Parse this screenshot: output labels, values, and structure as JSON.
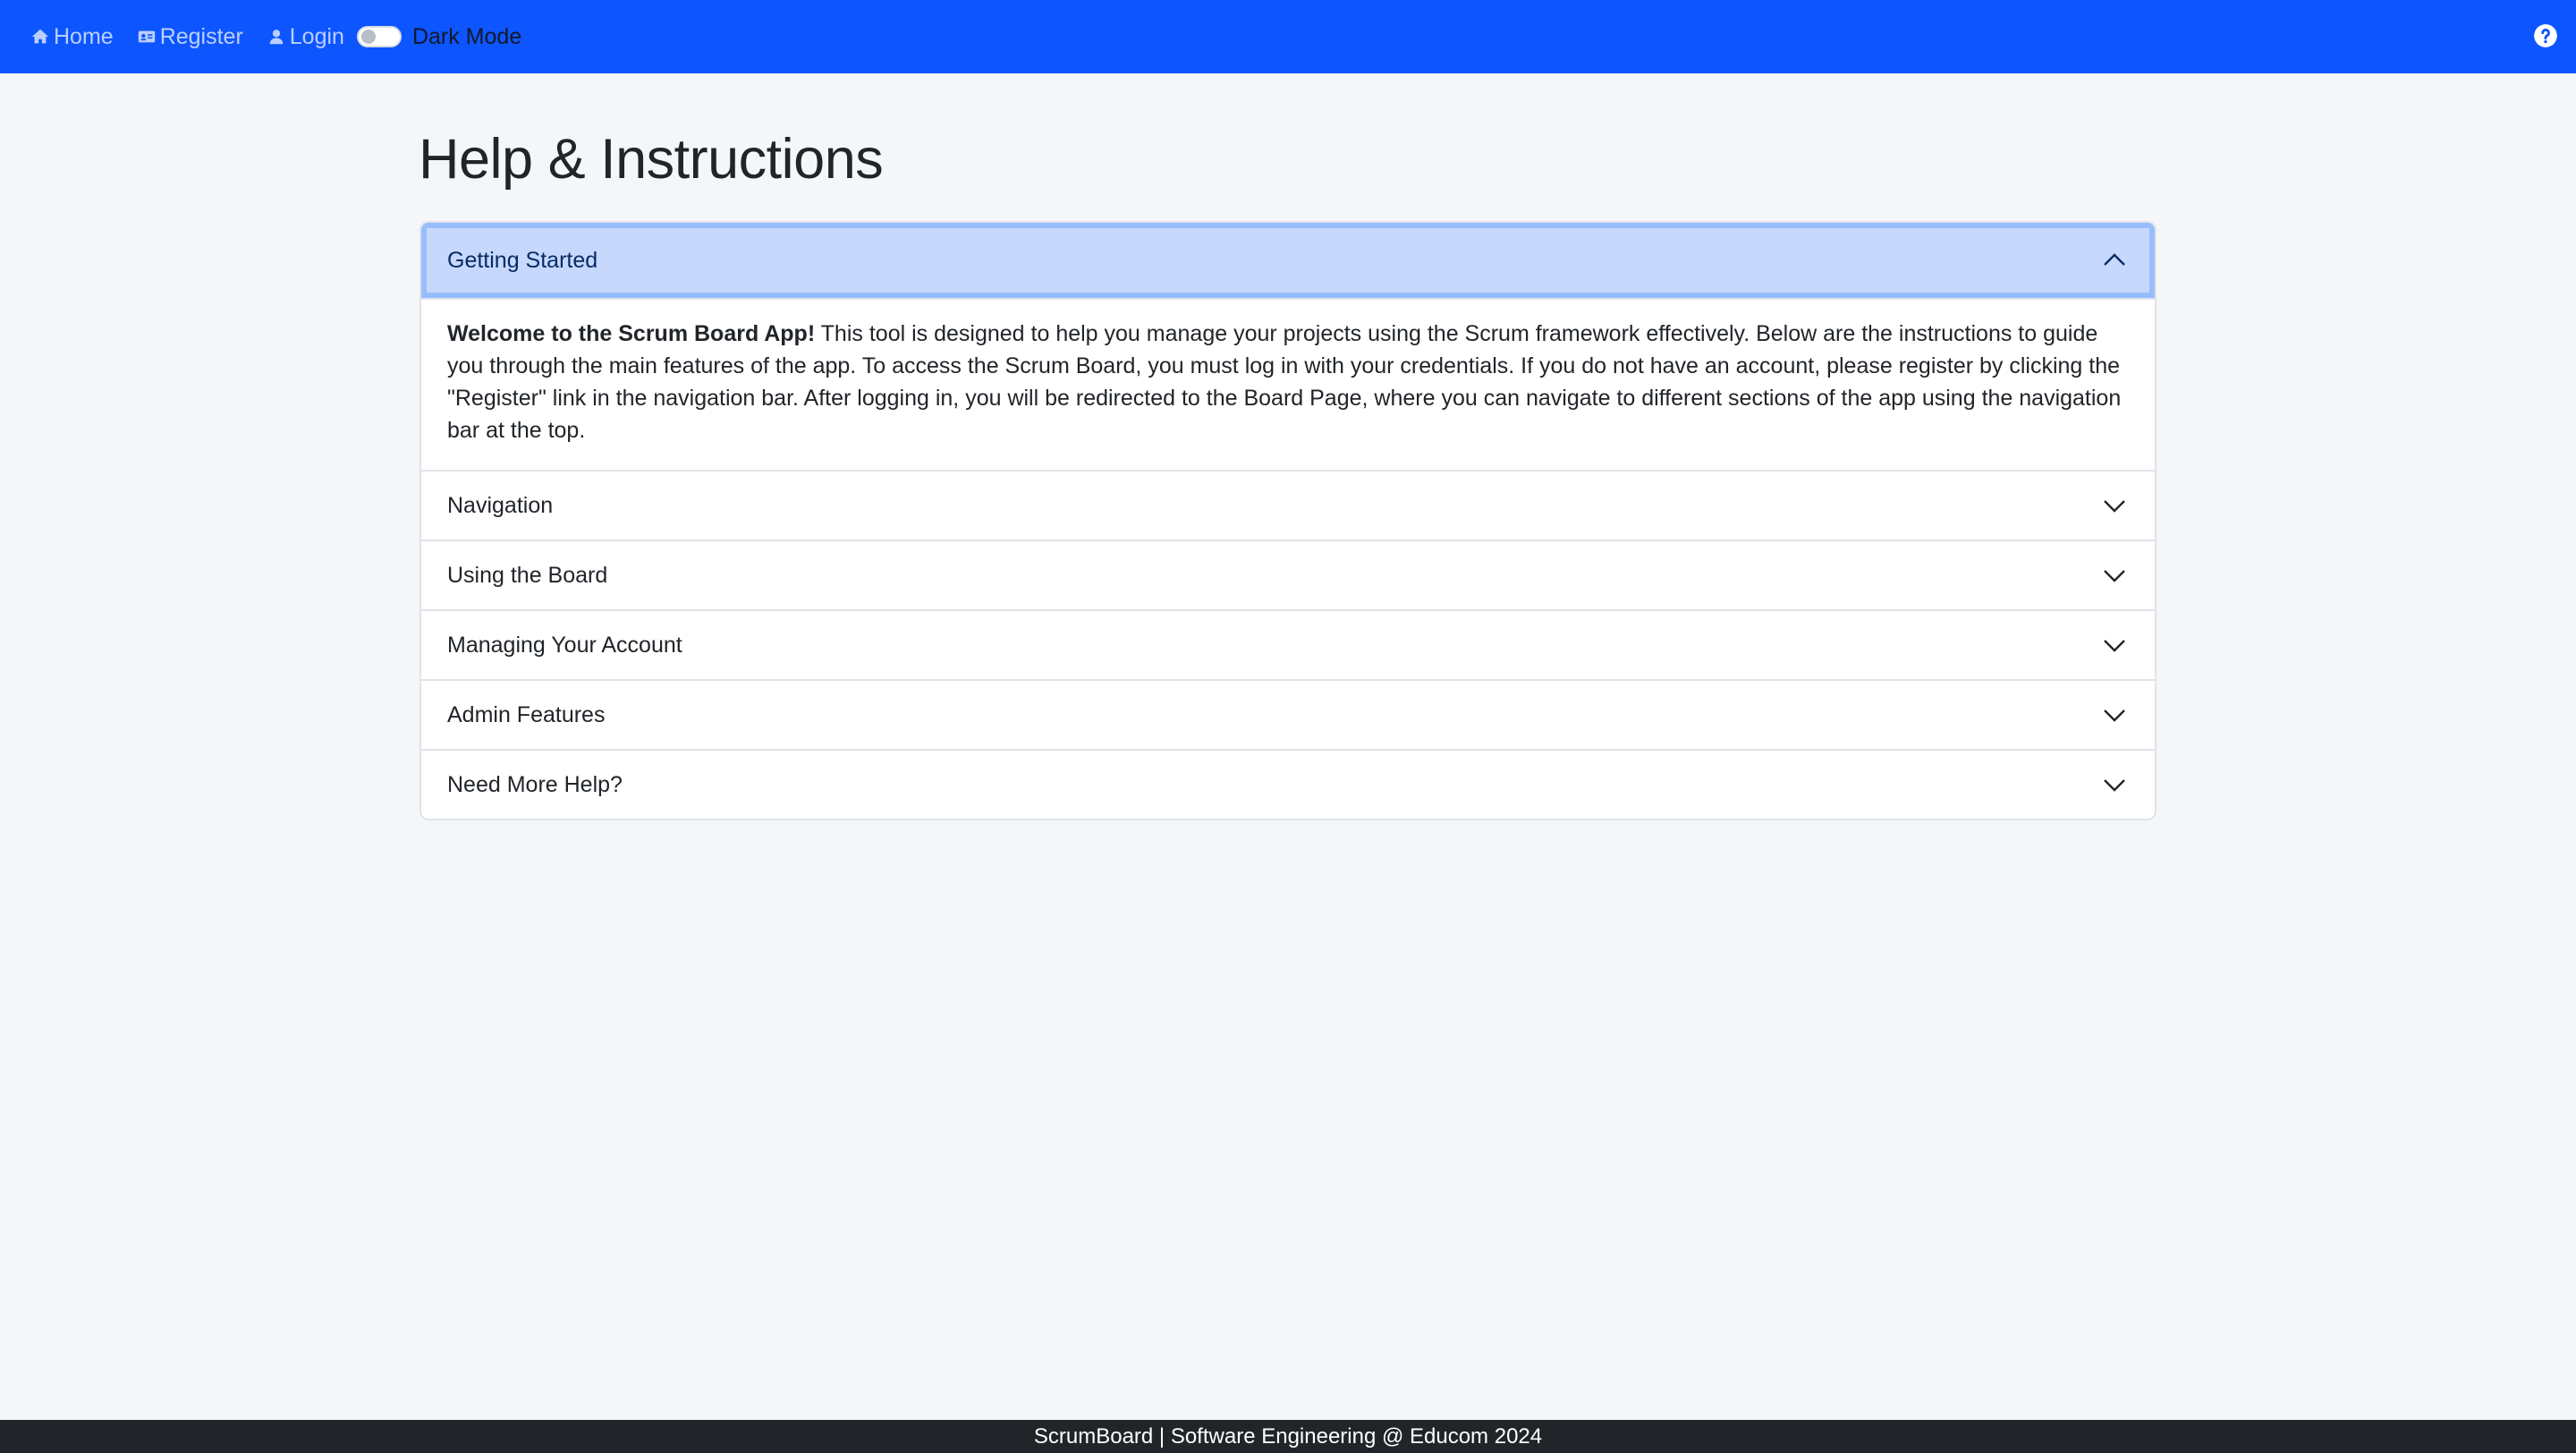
{
  "nav": {
    "home": "Home",
    "register": "Register",
    "login": "Login",
    "dark_mode": "Dark Mode",
    "home_icon": "house-icon",
    "register_icon": "id-card-icon",
    "login_icon": "user-icon",
    "help_icon": "question-circle-icon",
    "dark_mode_enabled": false
  },
  "page": {
    "title": "Help & Instructions"
  },
  "accordion": {
    "items": [
      {
        "title": "Getting Started",
        "expanded": true,
        "body_bold": "Welcome to the Scrum Board App!",
        "body_text": " This tool is designed to help you manage your projects using the Scrum framework effectively. Below are the instructions to guide you through the main features of the app. To access the Scrum Board, you must log in with your credentials. If you do not have an account, please register by clicking the \"Register\" link in the navigation bar. After logging in, you will be redirected to the Board Page, where you can navigate to different sections of the app using the navigation bar at the top."
      },
      {
        "title": "Navigation",
        "expanded": false
      },
      {
        "title": "Using the Board",
        "expanded": false
      },
      {
        "title": "Managing Your Account",
        "expanded": false
      },
      {
        "title": "Admin Features",
        "expanded": false
      },
      {
        "title": "Need More Help?",
        "expanded": false
      }
    ]
  },
  "footer": {
    "text": "ScrumBoard | Software Engineering @ Educom 2024"
  },
  "colors": {
    "navbar": "#0d55ff",
    "accordion_active": "#c6d8fc",
    "footer": "#212529",
    "background": "#f5f6f8"
  }
}
